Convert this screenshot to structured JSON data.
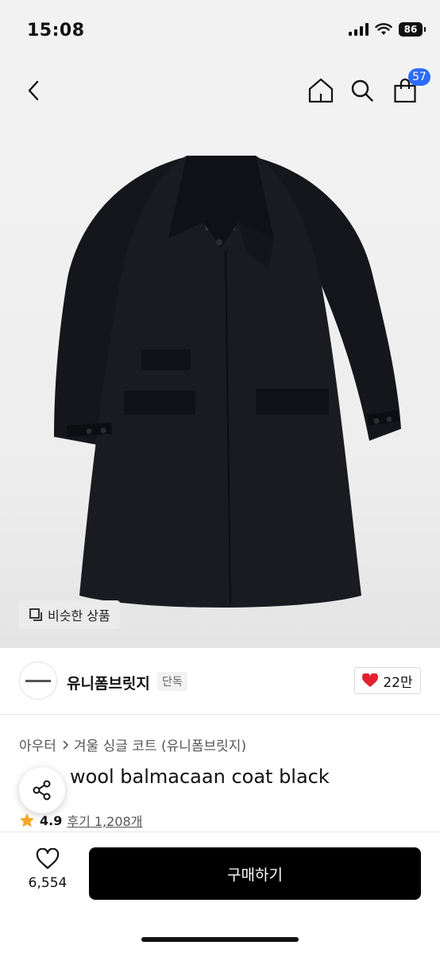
{
  "status_bar": {
    "time": "15:08",
    "battery": "86"
  },
  "nav": {
    "cart_count": "57"
  },
  "hero": {
    "similar_label": "비슷한 상품"
  },
  "seller": {
    "name": "유니폼브릿지",
    "tag": "단독",
    "likes": "22만"
  },
  "breadcrumb": {
    "category": "아우터",
    "subcategory": "겨울 싱글 코트 (유니폼브릿지)"
  },
  "product": {
    "title": "wool balmacaan coat black",
    "rating": "4.9",
    "reviews": "후기 1,208개"
  },
  "bottom_bar": {
    "wish_count": "6,554",
    "buy_label": "구매하기"
  },
  "colors": {
    "accent": "#2c6cf6",
    "like_heart": "#e5202e",
    "star": "#f5a623",
    "buy_button": "#000000"
  },
  "icons": [
    "chevron-left-icon",
    "home-icon",
    "search-icon",
    "shopping-bag-icon",
    "similar-icon",
    "heart-icon",
    "share-icon",
    "star-icon",
    "heart-outline-icon"
  ]
}
